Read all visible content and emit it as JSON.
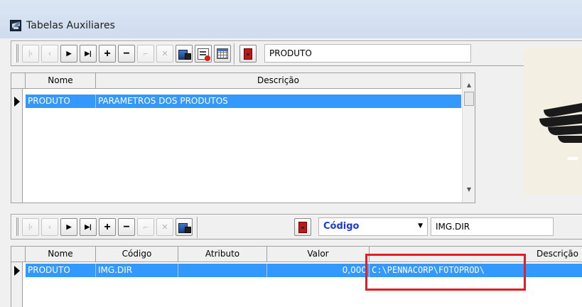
{
  "window": {
    "title": "Tabelas Auxiliares"
  },
  "top_toolbar": {
    "search_value": "PRODUTO"
  },
  "top_grid": {
    "columns": [
      "Nome",
      "Descrição"
    ],
    "rows": [
      {
        "nome": "PRODUTO",
        "descricao": "PARAMETROS DOS PRODUTOS",
        "selected": true
      }
    ]
  },
  "bottom_toolbar": {
    "field_combo_value": "Código",
    "search_value": "IMG.DIR"
  },
  "bottom_grid": {
    "columns": [
      "Nome",
      "Código",
      "Atributo",
      "Valor",
      "Descrição"
    ],
    "rows": [
      {
        "nome": "PRODUTO",
        "codigo": "IMG.DIR",
        "atributo": "",
        "valor": "0,000",
        "descricao": "C:\\PENNACORP\\FOTOPROD\\",
        "selected": true
      }
    ]
  },
  "icons": {
    "nav_first": "⏮",
    "nav_prior": "◀",
    "nav_next": "▶",
    "nav_last": "▶|",
    "insert": "+",
    "delete": "−",
    "post": "✓",
    "cancel": "✕"
  },
  "colors": {
    "selection": "#3399ff",
    "highlight": "#e11f26",
    "combo_text": "#1a3ad6"
  }
}
